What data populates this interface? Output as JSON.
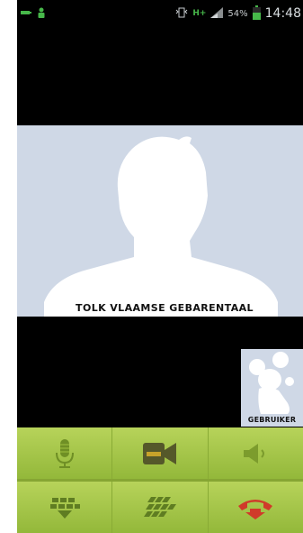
{
  "status_bar": {
    "battery_percent": "54%",
    "time": "14:48",
    "network": "H+"
  },
  "remote_video": {
    "label": "TOLK VLAAMSE GEBARENTAAL"
  },
  "self_video": {
    "label": "GEBRUIKER"
  },
  "controls": {
    "row1": [
      "microphone-icon",
      "video-camera-icon",
      "speaker-icon"
    ],
    "row2": [
      "dialpad-icon",
      "keyboard-icon",
      "hang-up-icon"
    ]
  },
  "colors": {
    "accent": "#9fc23f",
    "icon": "#6f8f25",
    "hangup": "#d03a2a",
    "placeholder": "#cfd8e6"
  }
}
